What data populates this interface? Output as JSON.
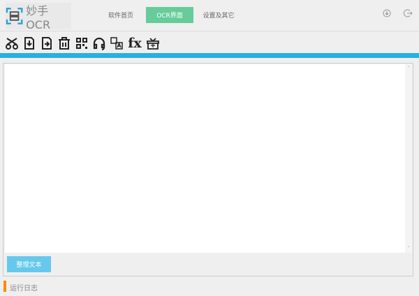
{
  "app": {
    "title": "妙手OCR"
  },
  "nav": {
    "tabs": [
      {
        "label": "软件首页"
      },
      {
        "label": "OCR界面",
        "active": true
      },
      {
        "label": "设置及其它"
      }
    ]
  },
  "header_icons": [
    "download-circle-icon",
    "logout-icon"
  ],
  "toolbar": [
    "screenshot-icon",
    "import-icon",
    "export-icon",
    "delete-icon",
    "qrcode-icon",
    "headphones-icon",
    "translate-icon",
    "formula-icon",
    "gift-icon"
  ],
  "editor": {
    "value": ""
  },
  "actions": {
    "tidy_label": "整理文本"
  },
  "log": {
    "title": "运行日志"
  },
  "colors": {
    "accent_green": "#66cc99",
    "blue_bar": "#29b0e0",
    "button": "#66c8ec",
    "log_marker": "#ff8800"
  }
}
